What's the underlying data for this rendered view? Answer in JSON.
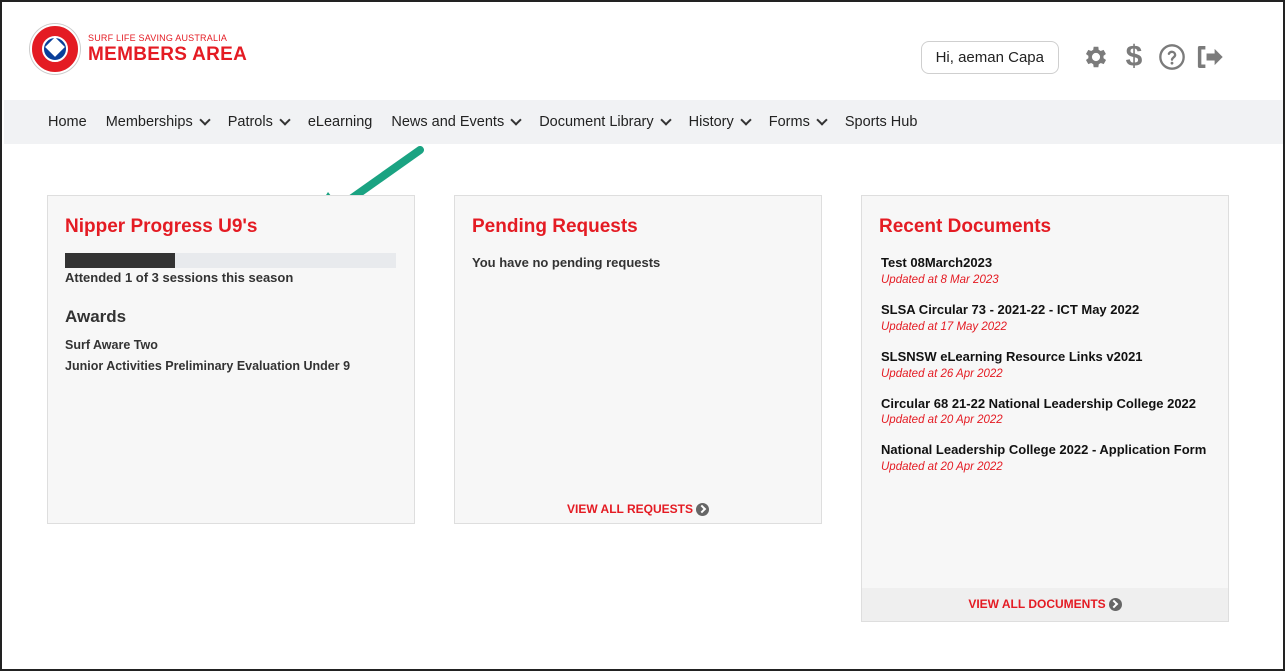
{
  "header": {
    "logo_small": "SURF LIFE SAVING AUSTRALIA",
    "logo_big": "MEMBERS AREA",
    "greeting": "Hi, aeman Capa",
    "icons": [
      "gear-icon",
      "dollar-icon",
      "help-icon",
      "logout-icon"
    ],
    "dollar_glyph": "$"
  },
  "nav": {
    "items": [
      {
        "label": "Home",
        "dropdown": false
      },
      {
        "label": "Memberships",
        "dropdown": true
      },
      {
        "label": "Patrols",
        "dropdown": true
      },
      {
        "label": "eLearning",
        "dropdown": false
      },
      {
        "label": "News and Events",
        "dropdown": true
      },
      {
        "label": "Document Library",
        "dropdown": true
      },
      {
        "label": "History",
        "dropdown": true
      },
      {
        "label": "Forms",
        "dropdown": true
      },
      {
        "label": "Sports Hub",
        "dropdown": false
      }
    ]
  },
  "nipper": {
    "title": "Nipper Progress U9's",
    "progress_fraction": 0.333,
    "progress_text": "Attended 1 of 3 sessions this season",
    "awards_title": "Awards",
    "awards": [
      "Surf Aware Two",
      "Junior Activities Preliminary Evaluation Under 9"
    ]
  },
  "pending": {
    "title": "Pending Requests",
    "message": "You have no pending requests",
    "view_all": "VIEW ALL REQUESTS"
  },
  "documents": {
    "title": "Recent Documents",
    "items": [
      {
        "title": "Test 08March2023",
        "updated": "Updated at 8 Mar 2023"
      },
      {
        "title": "SLSA Circular 73 - 2021-22 - ICT May 2022",
        "updated": "Updated at 17 May 2022"
      },
      {
        "title": "SLSNSW eLearning Resource Links v2021",
        "updated": "Updated at 26 Apr 2022"
      },
      {
        "title": "Circular 68 21-22 National Leadership College 2022",
        "updated": "Updated at 20 Apr 2022"
      },
      {
        "title": "National Leadership College 2022 - Application Form",
        "updated": "Updated at 20 Apr 2022"
      }
    ],
    "view_all": "VIEW ALL DOCUMENTS"
  },
  "colors": {
    "brand_red": "#e41b23",
    "annotation_arrow": "#1aa382"
  }
}
